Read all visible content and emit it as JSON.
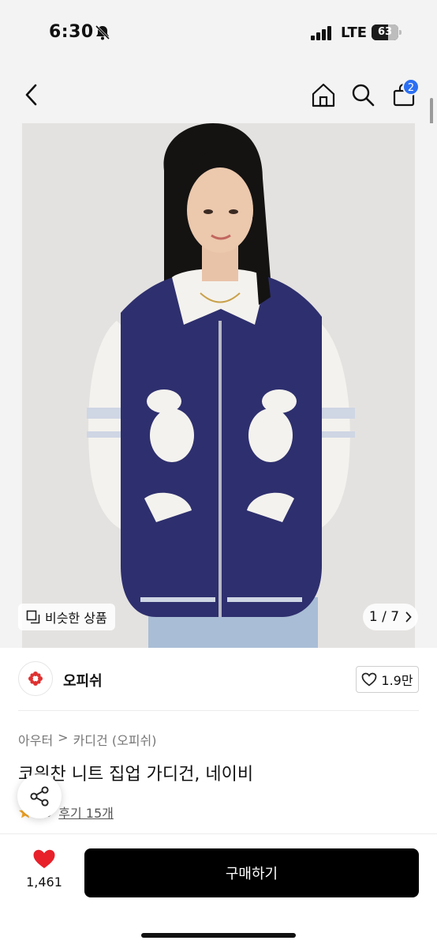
{
  "status_bar": {
    "time": "6:30",
    "network": "LTE",
    "battery_level": "63",
    "battery_fraction": 0.63
  },
  "nav": {
    "back_icon": "chevron-left-icon",
    "home_icon": "home-icon",
    "search_icon": "search-icon",
    "cart_icon": "bag-icon",
    "cart_badge": "2",
    "badge_color": "#2b6ff2"
  },
  "gallery": {
    "similar_label": "비슷한 상품",
    "counter": "1 / 7",
    "counter_icon": "chevron-right-icon",
    "sweater_color": "#2e2f6e"
  },
  "brand": {
    "name": "오피쉬",
    "logo_color": "#e03131",
    "likes": "1.9만"
  },
  "product": {
    "category": [
      "아우터",
      "카디건 (오피쉬)"
    ],
    "title": "코위찬 니트 집업 가디건, 네이비",
    "rating": ".9",
    "reviews": "후기 15개"
  },
  "bottom": {
    "wish_count": "1,461",
    "buy_label": "구매하기",
    "heart_color": "#e8202a"
  }
}
